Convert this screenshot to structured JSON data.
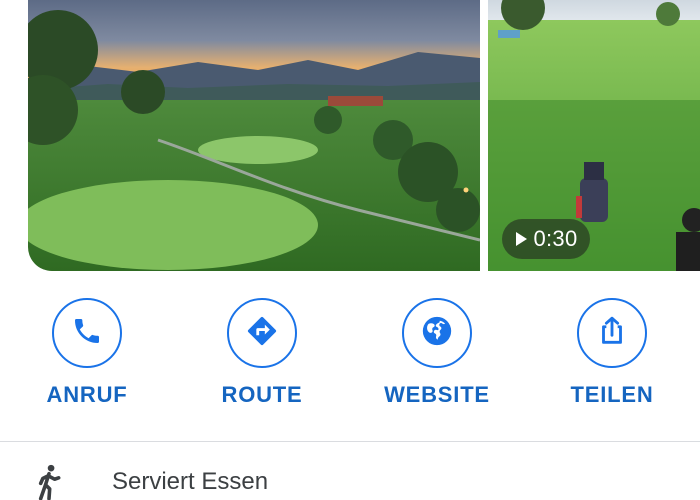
{
  "media": {
    "main_photo": {
      "alt": "golf-course-aerial-sunset-photo"
    },
    "video_photo": {
      "alt": "golf-fairway-video-thumbnail",
      "duration": "0:30"
    }
  },
  "actions": [
    {
      "id": "call",
      "label": "ANRUF",
      "icon": "phone-icon"
    },
    {
      "id": "route",
      "label": "ROUTE",
      "icon": "directions-icon"
    },
    {
      "id": "website",
      "label": "WEBSITE",
      "icon": "globe-icon"
    },
    {
      "id": "share",
      "label": "TEILEN",
      "icon": "share-icon"
    }
  ],
  "info": {
    "icon": "walking-person-icon",
    "text": "Serviert Essen"
  },
  "colors": {
    "accent": "#1a73e8",
    "label": "#1565c0",
    "text": "#3c4043",
    "divider": "#dadce0"
  }
}
